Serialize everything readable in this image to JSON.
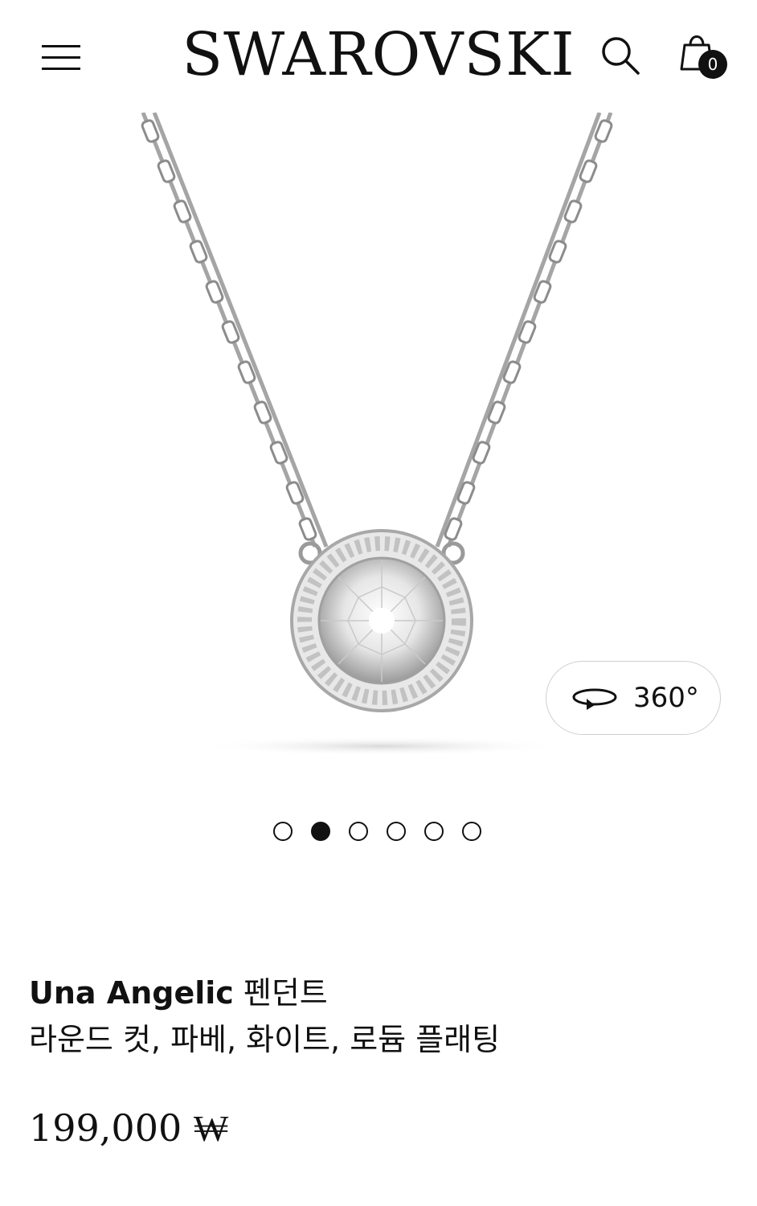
{
  "header": {
    "brand": "SWAROVSKI",
    "cart_count": "0",
    "icons": {
      "menu": "hamburger-menu-icon",
      "search": "search-icon",
      "cart": "shopping-bag-icon"
    }
  },
  "gallery": {
    "view360_label": "360°",
    "slide_count": 6,
    "active_slide": 2
  },
  "product": {
    "name": "Una Angelic",
    "type": "펜던트",
    "description": "라운드 컷, 파베, 화이트, 로듐 플래팅",
    "price": "199,000 ₩"
  },
  "colors": {
    "text": "#111111",
    "background": "#ffffff",
    "border": "#cfcfcf"
  }
}
